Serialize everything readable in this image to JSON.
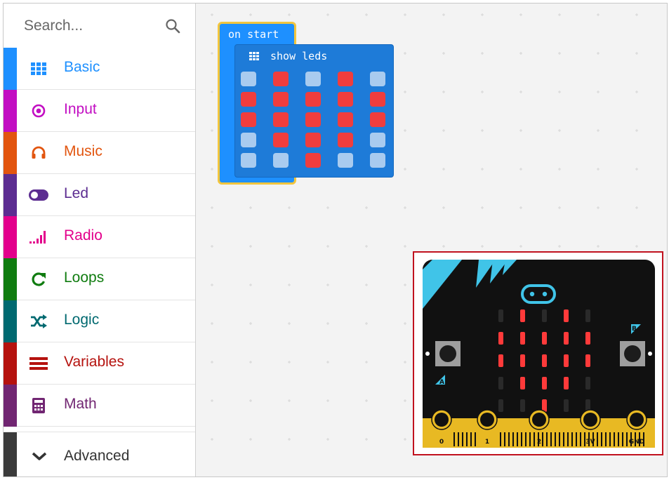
{
  "search": {
    "placeholder": "Search...",
    "icon": "magnifier-icon"
  },
  "categories": [
    {
      "label": "Basic",
      "color": "#1e90ff",
      "icon": "grid-icon"
    },
    {
      "label": "Input",
      "color": "#c20ec2",
      "icon": "target-icon"
    },
    {
      "label": "Music",
      "color": "#e2550f",
      "icon": "headphones-icon"
    },
    {
      "label": "Led",
      "color": "#5c2d91",
      "icon": "toggle-icon"
    },
    {
      "label": "Radio",
      "color": "#e3008c",
      "icon": "signal-bars-icon"
    },
    {
      "label": "Loops",
      "color": "#107c10",
      "icon": "refresh-icon"
    },
    {
      "label": "Logic",
      "color": "#006970",
      "icon": "shuffle-icon"
    },
    {
      "label": "Variables",
      "color": "#b5120e",
      "icon": "lines-icon"
    },
    {
      "label": "Math",
      "color": "#712672",
      "icon": "calculator-icon"
    }
  ],
  "advanced": {
    "label": "Advanced",
    "color": "#3b3b3b",
    "icon": "chevron-down-icon"
  },
  "blocks": {
    "on_start": {
      "label": "on start",
      "color": "#1e90ff",
      "border": "#f2c53d"
    },
    "show_leds": {
      "label": "show leds",
      "leds": [
        [
          0,
          1,
          0,
          1,
          0
        ],
        [
          1,
          1,
          1,
          1,
          1
        ],
        [
          1,
          1,
          1,
          1,
          1
        ],
        [
          0,
          1,
          1,
          1,
          0
        ],
        [
          0,
          0,
          1,
          0,
          0
        ]
      ],
      "on_color": "#f03d3d",
      "off_color": "#a9cbef"
    }
  },
  "simulator": {
    "button_a": "A",
    "button_b": "B",
    "pins": [
      "0",
      "1",
      "2",
      "3V",
      "GND"
    ],
    "accent": "#40c4e8",
    "frame_color": "#c1121f"
  }
}
